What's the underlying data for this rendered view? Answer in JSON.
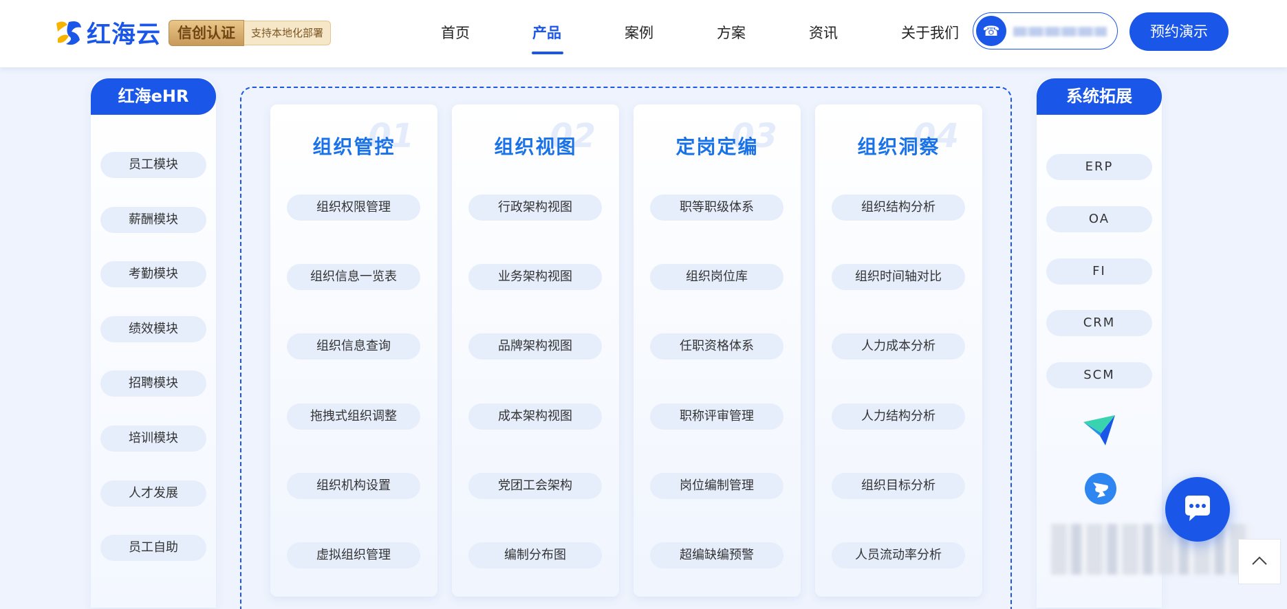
{
  "header": {
    "logo_text": "红海云",
    "badge_main": "信创认证",
    "badge_sub": "支持本地化部署",
    "nav": [
      "首页",
      "产品",
      "案例",
      "方案",
      "资讯",
      "关于我们"
    ],
    "active_nav": "产品",
    "demo_button": "预约演示"
  },
  "left_panel": {
    "title": "红海eHR",
    "items": [
      "员工模块",
      "薪酬模块",
      "考勤模块",
      "绩效模块",
      "招聘模块",
      "培训模块",
      "人才发展",
      "员工自助"
    ]
  },
  "cards": [
    {
      "num": "01",
      "title": "组织管控",
      "items": [
        "组织权限管理",
        "组织信息一览表",
        "组织信息查询",
        "拖拽式组织调整",
        "组织机构设置",
        "虚拟组织管理"
      ]
    },
    {
      "num": "02",
      "title": "组织视图",
      "items": [
        "行政架构视图",
        "业务架构视图",
        "品牌架构视图",
        "成本架构视图",
        "党团工会架构",
        "编制分布图"
      ]
    },
    {
      "num": "03",
      "title": "定岗定编",
      "items": [
        "职等职级体系",
        "组织岗位库",
        "任职资格体系",
        "职称评审管理",
        "岗位编制管理",
        "超编缺编预警"
      ]
    },
    {
      "num": "04",
      "title": "组织洞察",
      "items": [
        "组织结构分析",
        "组织时间轴对比",
        "人力成本分析",
        "人力结构分析",
        "组织目标分析",
        "人员流动率分析"
      ]
    }
  ],
  "right_panel": {
    "title": "系统拓展",
    "items": [
      "ERP",
      "OA",
      "FI",
      "CRM",
      "SCM"
    ],
    "icons": [
      "feishu-icon",
      "dingtalk-icon"
    ]
  },
  "colors": {
    "primary": "#1a56e8",
    "title_blue": "#1a72e8",
    "pill_bg": "#e6eefc",
    "page_bg": "#eef3fd"
  }
}
